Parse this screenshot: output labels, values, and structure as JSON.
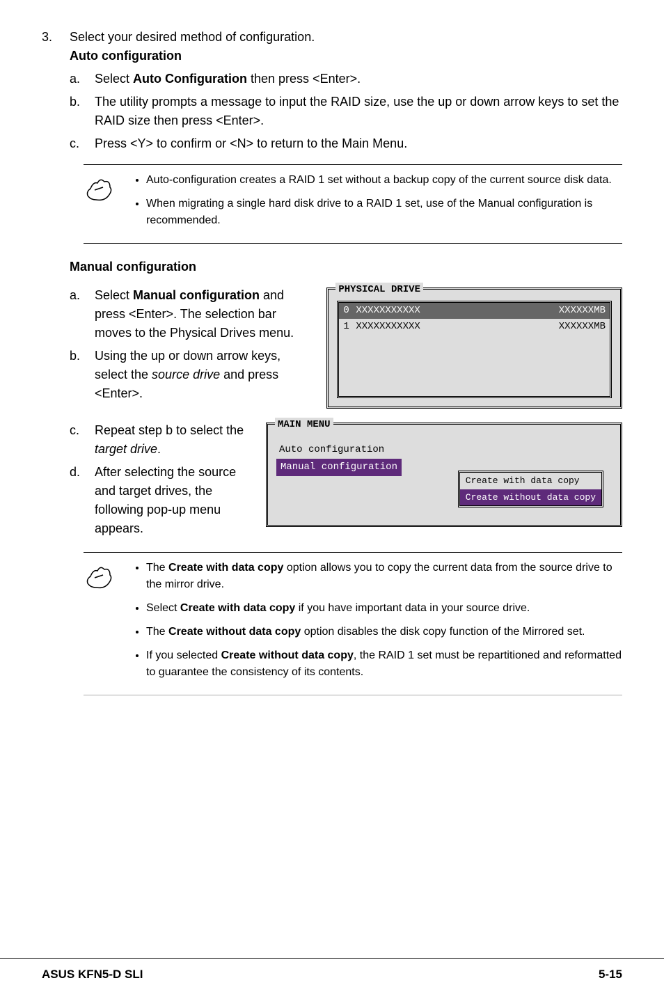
{
  "step3": {
    "number": "3.",
    "text": "Select your desired method of configuration.",
    "auto_heading": "Auto configuration",
    "a": {
      "l": "a.",
      "pre": "Select ",
      "bold": "Auto Configuration",
      "post": " then press <Enter>."
    },
    "b": {
      "l": "b.",
      "text": "The utility prompts a message to input the RAID size, use the up or down arrow keys to set the RAID size then press <Enter>."
    },
    "c": {
      "l": "c.",
      "text": "Press <Y> to confirm or <N> to return to the Main Menu."
    }
  },
  "note1": {
    "b1": "Auto-configuration creates a RAID 1 set without a backup copy of the current source disk data.",
    "b2": "When migrating a single hard disk drive to a RAID 1 set, use of the Manual configuration is recommended."
  },
  "manual": {
    "heading": "Manual configuration",
    "a": {
      "l": "a.",
      "pre": "Select ",
      "bold": "Manual configuration",
      "post": " and press <Enter>. The selection bar moves to the Physical Drives menu."
    },
    "b": {
      "l": "b.",
      "pre": "Using the up or down arrow keys, select the ",
      "it": "source drive",
      "post": " and press <Enter>."
    },
    "c": {
      "l": "c.",
      "pre": "Repeat step b to select the ",
      "it": "target drive",
      "post": "."
    },
    "d": {
      "l": "d.",
      "text": "After selecting the source and target drives, the following pop-up menu appears."
    }
  },
  "tui1": {
    "title": "PHYSICAL DRIVE",
    "r0": {
      "idx": "0",
      "name": "XXXXXXXXXXX",
      "size": "XXXXXXMB"
    },
    "r1": {
      "idx": "1",
      "name": "XXXXXXXXXXX",
      "size": "XXXXXXMB"
    }
  },
  "tui2": {
    "title": "MAIN MENU",
    "line1": "Auto configuration",
    "line2": "Manual configuration",
    "pop1": "Create with data copy",
    "pop2": "Create without data copy"
  },
  "note2": {
    "b1_pre": "The ",
    "b1_bold": "Create with data copy",
    "b1_post": " option allows you to copy the current data from the source drive to the mirror drive.",
    "b2_pre": "Select ",
    "b2_bold": "Create with data copy",
    "b2_post": " if you have important data in your source drive.",
    "b3_pre": "The ",
    "b3_bold": "Create without data copy",
    "b3_post": " option disables the disk copy function of the Mirrored set.",
    "b4_pre": "If you selected ",
    "b4_bold": "Create without data copy",
    "b4_post": ", the RAID 1 set must be repartitioned and reformatted to guarantee the consistency of its contents."
  },
  "footer": {
    "left": "ASUS KFN5-D SLI",
    "right": "5-15"
  }
}
